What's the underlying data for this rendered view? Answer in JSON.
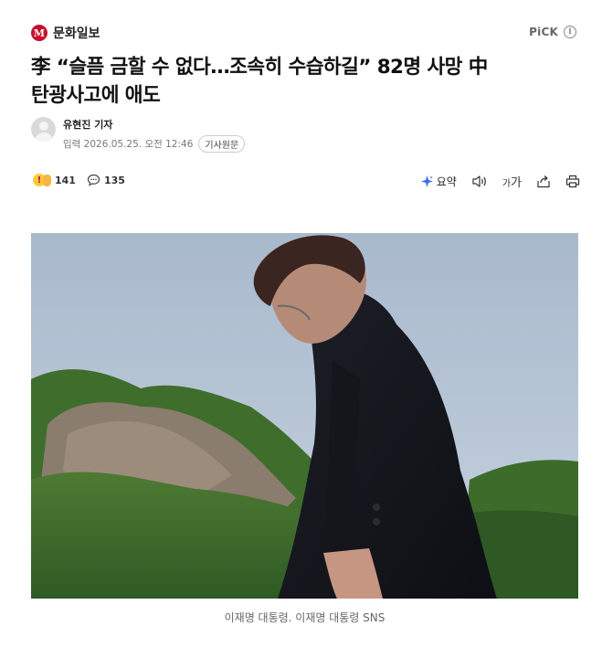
{
  "press": {
    "logo_letter": "M",
    "name": "문화일보"
  },
  "pick": {
    "label": "PiCK",
    "info_icon": "info-icon"
  },
  "article": {
    "headline_line1": "李 “슬픔 금할 수 없다…조속히 수습하길” 82명 사망 中",
    "headline_line2": "탄광사고에 애도",
    "reporter": "유현진 기자",
    "date": "입력 2026.05.25. 오전 12:46",
    "original_button": "기사원문"
  },
  "reactions": {
    "react_count": "141",
    "comment_count": "135",
    "react_icon": "reaction-emoji-icon",
    "comment_icon": "comment-bubble-icon"
  },
  "tools": {
    "summary_label": "요약",
    "font_small": "가",
    "font_large": "가",
    "icons": [
      "summary-sparkle-icon",
      "speaker-icon",
      "font-size-icon",
      "share-icon",
      "print-icon"
    ]
  },
  "photo": {
    "caption": "이재명 대통령. 이재명 대통령 SNS"
  },
  "colors": {
    "brand_red": "#c8102e",
    "summary_blue": "#3b6df0"
  }
}
